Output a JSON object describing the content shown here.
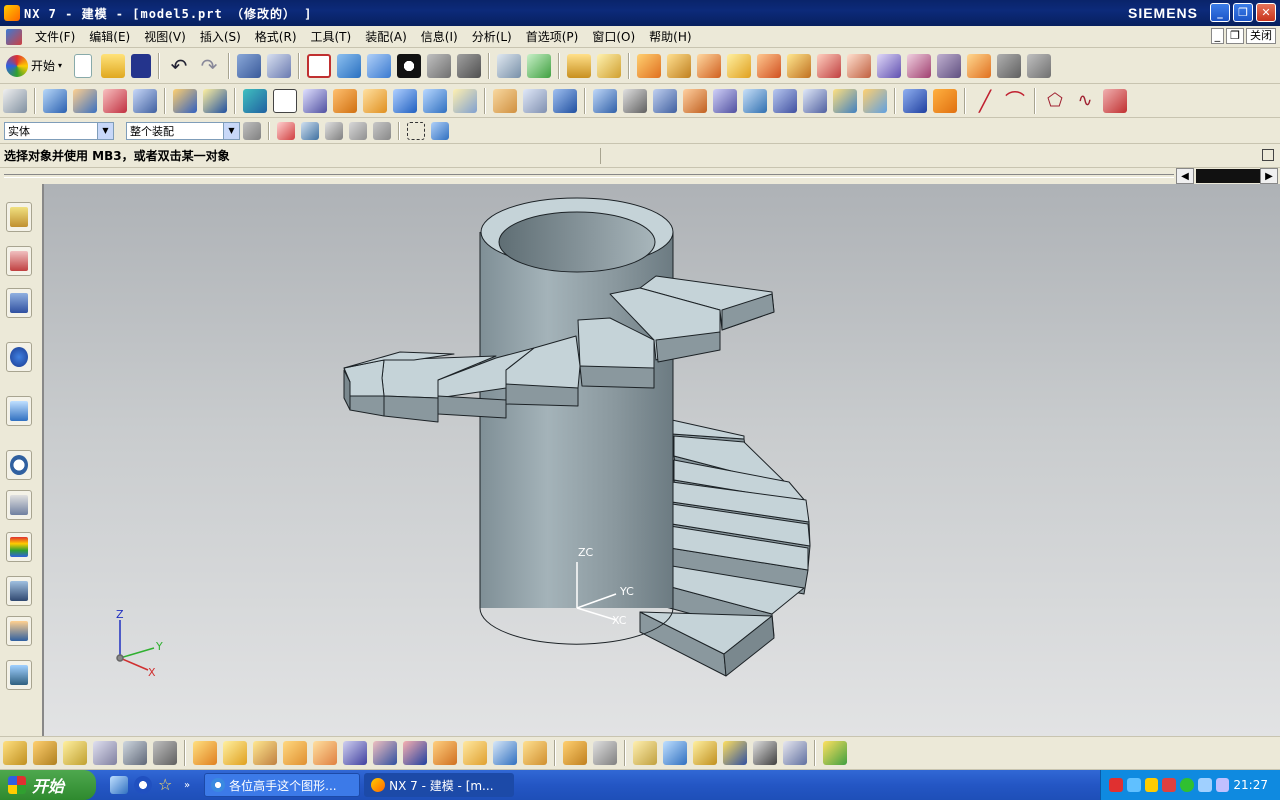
{
  "window": {
    "title": "NX 7 - 建模 - [model5.prt （修改的） ]",
    "brand": "SIEMENS",
    "controls": [
      "_",
      "❐",
      "✕"
    ]
  },
  "menubar": {
    "items": [
      "文件(F)",
      "编辑(E)",
      "视图(V)",
      "插入(S)",
      "格式(R)",
      "工具(T)",
      "装配(A)",
      "信息(I)",
      "分析(L)",
      "首选项(P)",
      "窗口(O)",
      "帮助(H)"
    ],
    "close_label": "关闭"
  },
  "toolbar": {
    "start_label": "开始"
  },
  "selection": {
    "type_filter": "实体",
    "scope_filter": "整个装配"
  },
  "prompt": {
    "text": "选择对象并使用 MB3，或者双击某一对象"
  },
  "viewport": {
    "wcs_labels": {
      "z": "ZC",
      "y": "YC",
      "x": "XC"
    },
    "abs_labels": {
      "z": "Z",
      "y": "Y",
      "x": "X"
    }
  },
  "taskbar": {
    "start_label": "开始",
    "tasks": [
      {
        "label": "各位高手这个图形..."
      },
      {
        "label": "NX 7 - 建模 - [m..."
      }
    ],
    "clock": "21:27"
  },
  "colors": {
    "model_fill": "#9aa8ae",
    "model_light": "#c5d3d8",
    "model_dark": "#6c7b82",
    "edge": "#1c2226"
  }
}
